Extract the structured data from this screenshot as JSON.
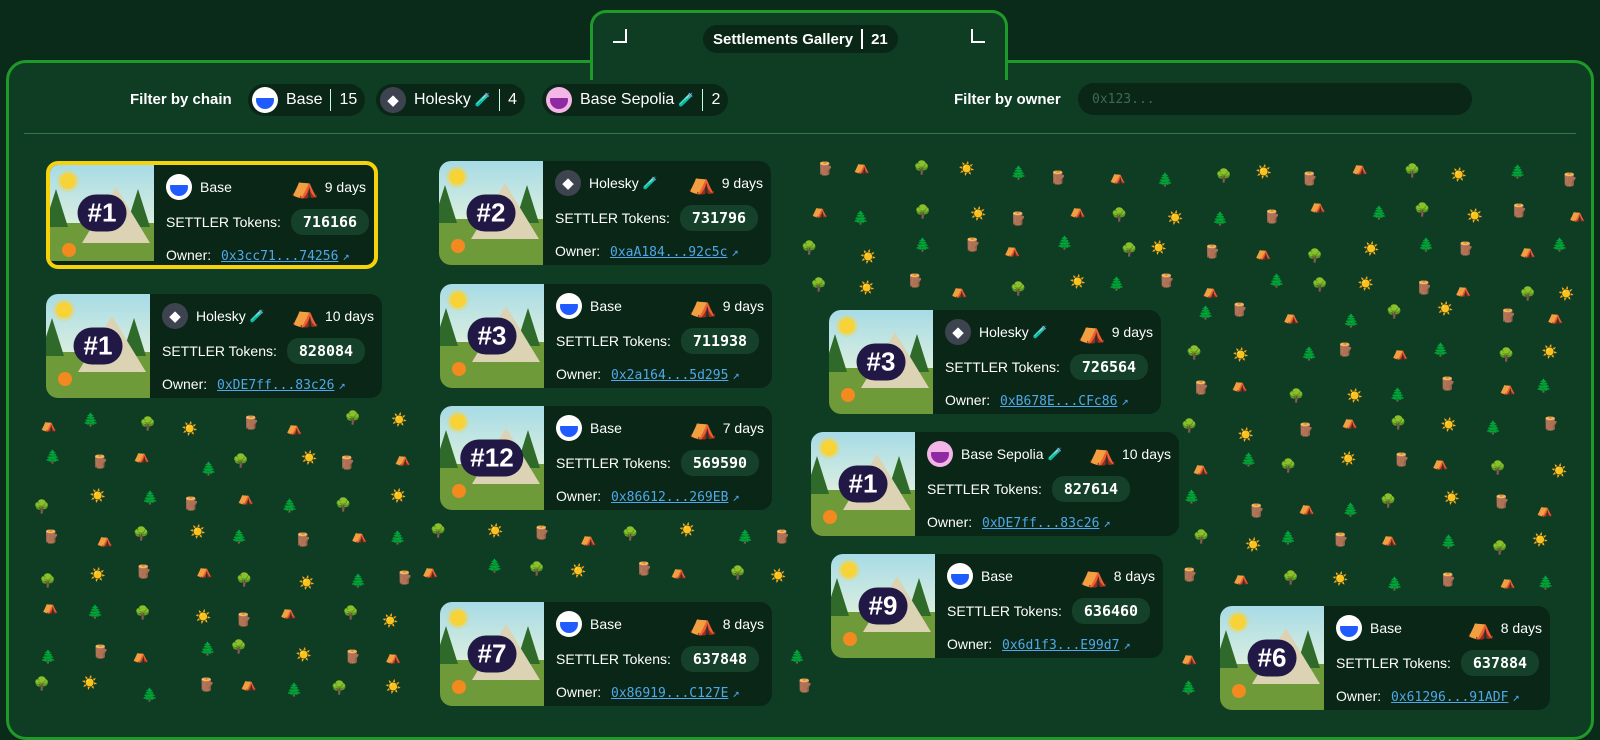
{
  "header": {
    "title": "Settlements Gallery",
    "count": "21"
  },
  "filters": {
    "chain_label": "Filter by chain",
    "chains": [
      {
        "name": "Base",
        "icon": "base-chain-icon",
        "count": "15",
        "pen": ""
      },
      {
        "name": "Holesky",
        "icon": "ethereum-chain-icon",
        "count": "4",
        "pen": "🧪"
      },
      {
        "name": "Base Sepolia",
        "icon": "base-sepolia-chain-icon",
        "count": "2",
        "pen": "🧪"
      }
    ],
    "owner_label": "Filter by owner",
    "owner_placeholder": "0x123..."
  },
  "labels": {
    "tokens": "SETTLER Tokens:",
    "owner": "Owner:"
  },
  "colors": {
    "accent": "#1e9a2a",
    "selected": "#f5d20c",
    "link": "#4fa8e8"
  },
  "cards": [
    {
      "num": "#1",
      "chain": "Base",
      "testnet": "",
      "days": "9 days",
      "tokens": "716166",
      "owner": "0x3cc71...74256"
    },
    {
      "num": "#1",
      "chain": "Holesky",
      "testnet": "🧪",
      "days": "10 days",
      "tokens": "828084",
      "owner": "0xDE7ff...83c26"
    },
    {
      "num": "#2",
      "chain": "Holesky",
      "testnet": "🧪",
      "days": "9 days",
      "tokens": "731796",
      "owner": "0xaA184...92c5c"
    },
    {
      "num": "#3",
      "chain": "Base",
      "testnet": "",
      "days": "9 days",
      "tokens": "711938",
      "owner": "0x2a164...5d295"
    },
    {
      "num": "#12",
      "chain": "Base",
      "testnet": "",
      "days": "7 days",
      "tokens": "569590",
      "owner": "0x86612...269EB"
    },
    {
      "num": "#7",
      "chain": "Base",
      "testnet": "",
      "days": "8 days",
      "tokens": "637848",
      "owner": "0x86919...C127E"
    },
    {
      "num": "#3",
      "chain": "Holesky",
      "testnet": "🧪",
      "days": "9 days",
      "tokens": "726564",
      "owner": "0xB678E...CFc86"
    },
    {
      "num": "#1",
      "chain": "Base Sepolia",
      "testnet": "🧪",
      "days": "10 days",
      "tokens": "827614",
      "owner": "0xDE7ff...83c26"
    },
    {
      "num": "#9",
      "chain": "Base",
      "testnet": "",
      "days": "8 days",
      "tokens": "636460",
      "owner": "0x6d1f3...E99d7"
    },
    {
      "num": "#6",
      "chain": "Base",
      "testnet": "",
      "days": "8 days",
      "tokens": "637884",
      "owner": "0x61296...91ADF"
    }
  ],
  "decorations": [
    "⛺",
    "🌲",
    "🌳",
    "☀️",
    "🪵",
    "⛺",
    "🌳",
    "☀️",
    "🌲",
    "🪵"
  ]
}
